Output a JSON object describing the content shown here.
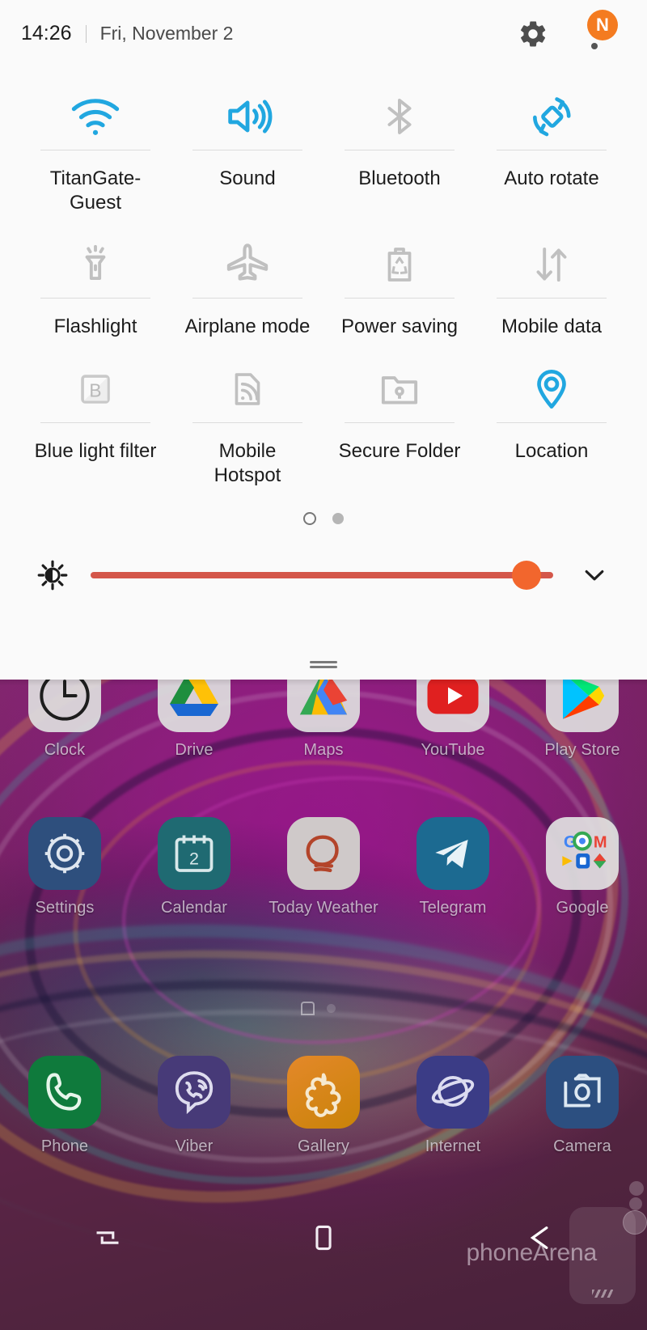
{
  "status_bar": {
    "time": "14:26",
    "date": "Fri, November 2",
    "settings_icon": "gear-icon",
    "more_icon": "more-vertical-icon",
    "badge_label": "N",
    "badge_color": "#f47b20"
  },
  "quick_settings": {
    "active_color": "#21a7e0",
    "inactive_color": "#bfbfbf",
    "tiles": [
      {
        "label": "TitanGate-Guest",
        "icon": "wifi-icon",
        "active": true
      },
      {
        "label": "Sound",
        "icon": "sound-icon",
        "active": true
      },
      {
        "label": "Bluetooth",
        "icon": "bluetooth-icon",
        "active": false
      },
      {
        "label": "Auto rotate",
        "icon": "auto-rotate-icon",
        "active": true
      },
      {
        "label": "Flashlight",
        "icon": "flashlight-icon",
        "active": false
      },
      {
        "label": "Airplane mode",
        "icon": "airplane-icon",
        "active": false
      },
      {
        "label": "Power saving",
        "icon": "power-saving-icon",
        "active": false
      },
      {
        "label": "Mobile data",
        "icon": "mobile-data-icon",
        "active": false
      },
      {
        "label": "Blue light filter",
        "icon": "blue-light-icon",
        "active": false
      },
      {
        "label": "Mobile Hotspot",
        "icon": "hotspot-icon",
        "active": false
      },
      {
        "label": "Secure Folder",
        "icon": "secure-folder-icon",
        "active": false
      },
      {
        "label": "Location",
        "icon": "location-pin-icon",
        "active": true
      }
    ],
    "page_dots": {
      "count": 2,
      "current": 1
    },
    "brightness": {
      "icon": "brightness-icon",
      "value_percent": 95,
      "track_color": "#d4574a",
      "knob_color": "#f2662d",
      "expand_icon": "chevron-down-icon"
    },
    "handle": "drag-handle"
  },
  "home_screen": {
    "rows": [
      [
        {
          "label": "Clock",
          "icon": "clock-icon"
        },
        {
          "label": "Drive",
          "icon": "google-drive-icon"
        },
        {
          "label": "Maps",
          "icon": "google-maps-icon"
        },
        {
          "label": "YouTube",
          "icon": "youtube-icon"
        },
        {
          "label": "Play Store",
          "icon": "play-store-icon"
        }
      ],
      [
        {
          "label": "Settings",
          "icon": "settings-gear-icon"
        },
        {
          "label": "Calendar",
          "icon": "calendar-icon",
          "day": "2"
        },
        {
          "label": "Today Weather",
          "icon": "today-weather-icon"
        },
        {
          "label": "Telegram",
          "icon": "telegram-icon"
        },
        {
          "label": "Google",
          "icon": "google-folder-icon"
        }
      ]
    ],
    "dock": [
      {
        "label": "Phone",
        "icon": "phone-icon"
      },
      {
        "label": "Viber",
        "icon": "viber-icon"
      },
      {
        "label": "Gallery",
        "icon": "gallery-icon"
      },
      {
        "label": "Internet",
        "icon": "internet-icon"
      },
      {
        "label": "Camera",
        "icon": "camera-icon"
      }
    ],
    "page_indicator": {
      "pages": 2,
      "current": 1
    }
  },
  "nav_bar": {
    "recents": "recents-icon",
    "home": "home-icon",
    "back": "back-icon"
  },
  "watermark": {
    "text": "phoneArena"
  }
}
